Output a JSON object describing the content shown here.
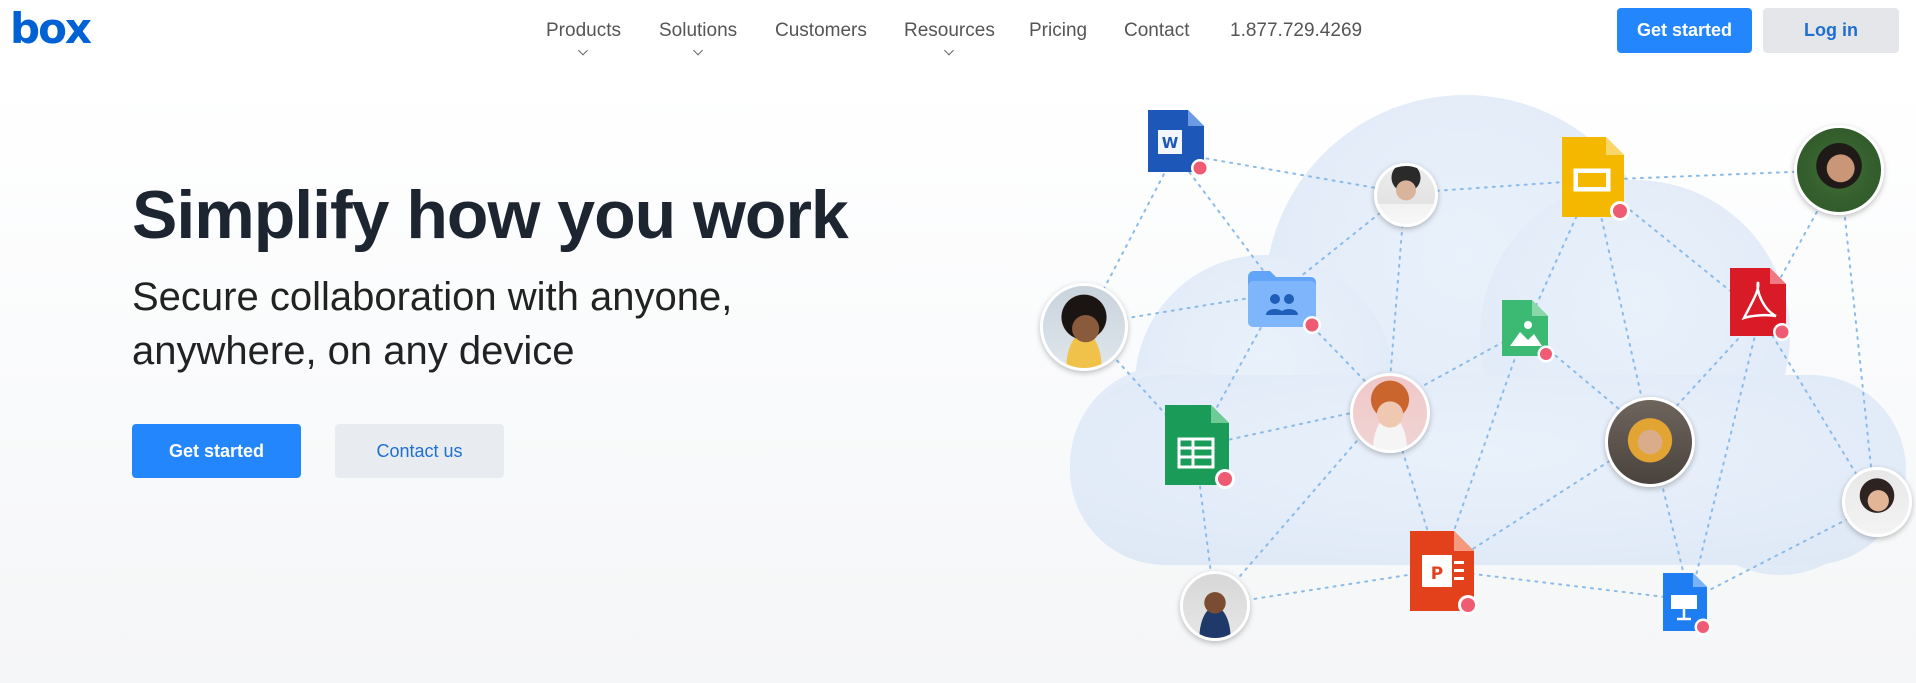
{
  "header": {
    "logo": "box",
    "nav": [
      {
        "label": "Products",
        "caret": true
      },
      {
        "label": "Solutions",
        "caret": true
      },
      {
        "label": "Customers",
        "caret": false
      },
      {
        "label": "Resources",
        "caret": true
      },
      {
        "label": "Pricing",
        "caret": false
      },
      {
        "label": "Contact",
        "caret": false
      },
      {
        "label": "1.877.729.4269",
        "caret": false
      }
    ],
    "get_started": "Get started",
    "log_in": "Log in"
  },
  "hero": {
    "title": "Simplify how you work",
    "subtitle": "Secure collaboration with anyone, anywhere, on any device",
    "primary_cta": "Get started",
    "secondary_cta": "Contact us"
  },
  "colors": {
    "brand": "#0061d5",
    "primary_button": "#2486fc",
    "word": "#1d57b8",
    "slides": "#f5b800",
    "pdf": "#d81b27",
    "sheets": "#1a9b57",
    "image": "#3cba74",
    "powerpoint": "#e2411b",
    "keynote": "#1e7df0",
    "folder": "#62a4f7",
    "cloud": "#e6eef8",
    "lock_badge": "#ef5b73"
  },
  "illustration": {
    "icons": [
      "word-doc-icon",
      "slides-icon",
      "pdf-icon",
      "shared-folder-icon",
      "image-file-icon",
      "spreadsheet-icon",
      "powerpoint-icon",
      "keynote-icon"
    ]
  }
}
